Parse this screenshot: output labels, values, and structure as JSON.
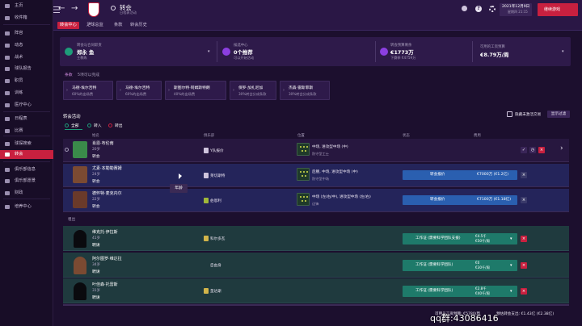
{
  "sidebar": {
    "items": [
      {
        "label": "主页",
        "active": false
      },
      {
        "label": "收件箱",
        "active": false
      },
      {
        "label": "阵容",
        "active": false
      },
      {
        "label": "动态",
        "active": false
      },
      {
        "label": "战术",
        "active": false
      },
      {
        "label": "球队报告",
        "active": false
      },
      {
        "label": "职员",
        "active": false
      },
      {
        "label": "训练",
        "active": false
      },
      {
        "label": "医疗中心",
        "active": false
      },
      {
        "label": "日程表",
        "active": false
      },
      {
        "label": "比赛",
        "active": false
      },
      {
        "label": "球探搜索",
        "active": false
      },
      {
        "label": "转会",
        "active": true
      },
      {
        "label": "俱乐部信息",
        "active": false
      },
      {
        "label": "俱乐部愿景",
        "active": false
      },
      {
        "label": "财政",
        "active": false
      },
      {
        "label": "培养中心",
        "active": false
      }
    ]
  },
  "topbar": {
    "title": "转会",
    "subtitle": "日程表活动",
    "date_line1": "2021年12月9日",
    "date_line2": "星期四 21:15",
    "continue_label": "继续游戏"
  },
  "subnav": {
    "tabs": [
      {
        "label": "转会中心",
        "active": true
      },
      {
        "label": "足球总监",
        "active": false
      },
      {
        "label": "条款",
        "active": false
      },
      {
        "label": "转会历史",
        "active": false
      }
    ]
  },
  "summary": {
    "director_label": "转会与合同职责",
    "director_name": "郑永 鱼",
    "director_sub": "主教练",
    "shortlist_label": "候选中心",
    "shortlist_value": "0个推荐",
    "shortlist_sub": "可以开始活动",
    "budget_label": "转会预算剩余",
    "budget_value": "€1773万",
    "budget_sub": "下赛季 €4759万",
    "wage_label": "可用的工资预算",
    "wage_value": "€8.79万/周"
  },
  "breadcrumb": {
    "part1": "条款",
    "part2": "5项可以完成"
  },
  "cards": [
    {
      "title": "马德·埃尔吉特",
      "sub": "60%的出场费"
    },
    {
      "title": "马德·埃尔吉特",
      "sub": "60%的出场费"
    },
    {
      "title": "斯图尔特·阿姆斯特朗",
      "sub": "40%的出场费"
    },
    {
      "title": "保罗·加扎尼加",
      "sub": "30%转会分成条款"
    },
    {
      "title": "杰森·雷斯菲斯",
      "sub": "30%转会分成条款"
    }
  ],
  "activity": {
    "title": "转会活动",
    "hide_label": "隐藏未激活交易",
    "filter_label": "显示过滤",
    "filters": [
      {
        "label": "全部",
        "active": true
      },
      {
        "label": "转入",
        "active": false
      },
      {
        "label": "转出",
        "active": false
      }
    ],
    "col_player": "姓名",
    "col_club": "俱乐部",
    "col_position": "位置",
    "col_status": "状态",
    "col_fee": "费用"
  },
  "tooltip": "年龄",
  "rows_top": [
    {
      "name": "肖恩·布伦南",
      "age": "20岁",
      "status": "转会",
      "club": "Y队报价",
      "pos": "中场, 进攻型中场 (中)",
      "pos_sub": "防守型工士",
      "action": "",
      "fee": ""
    },
    {
      "name": "尤素·本勒勒赛姆",
      "age": "24岁",
      "status": "转会",
      "club": "莱切斯特",
      "pos": "后腰, 中场, 进攻型中场 (中)",
      "pos_sub": "防守型中场",
      "action": "转会报价",
      "fee": "€7000万 (€1.2亿)"
    },
    {
      "name": "德怀特·麦克内尔",
      "age": "22岁",
      "status": "转会",
      "club": "伯恩利",
      "pos": "中场 (左/右/中), 进攻型中场 (左/右)",
      "pos_sub": "边锋",
      "action": "转会报价",
      "fee": "€7100万 (€1.18亿)"
    }
  ],
  "section_outgoing": "租出",
  "rows_bottom": [
    {
      "name": "维克托·伊拉斯",
      "age": "41岁",
      "status": "聘请",
      "club": "科尔多瓦",
      "action": "工作证 (需要科学团队支援)",
      "fee1": "€4.5千",
      "fee2": "€50千/周"
    },
    {
      "name": "阿尔图罗·维达拉",
      "age": "34岁",
      "status": "聘请",
      "club": "自由身",
      "action": "工作证 (需要科学团队)",
      "fee1": "€0",
      "fee2": "€30千/周"
    },
    {
      "name": "叶佳森·托雷斯",
      "age": "31岁",
      "status": "聘请",
      "club": "圣达斯",
      "action": "工作证 (需要科学团队)",
      "fee1": "€2.8千",
      "fee2": "€40千/周"
    }
  ],
  "footer": {
    "wage_text": "可用员工资预算: €5780/周",
    "budget_text": "预估转会支出: €1.43亿 (€2.38亿)"
  },
  "watermark": "qq群:43086416"
}
